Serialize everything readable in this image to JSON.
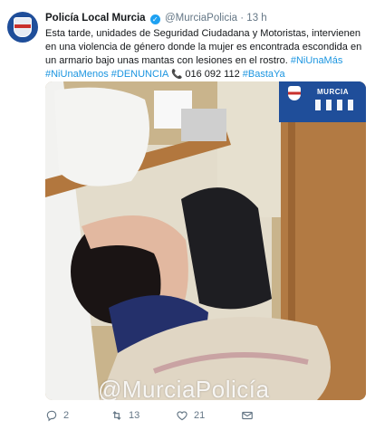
{
  "tweet": {
    "name": "Policía Local Murcia",
    "handle": "@MurciaPolicia",
    "separator": "·",
    "time": "13 h",
    "text_parts": [
      {
        "text": "Esta tarde, unidades de Seguridad Ciudadana y Motoristas, intervienen en una violencia de género donde la mujer es encontrada escondida en un armario bajo unas mantas con lesiones en el rostro. ",
        "type": "plain"
      },
      {
        "text": "#NiUnaMás",
        "type": "tag"
      },
      {
        "text": " ",
        "type": "plain"
      },
      {
        "text": "#NiUnaMenos",
        "type": "tag"
      },
      {
        "text": " ",
        "type": "plain"
      },
      {
        "text": "#DENUNCIA",
        "type": "tag"
      },
      {
        "text": " 📞 ",
        "type": "emoji"
      },
      {
        "text": "016 092 112 ",
        "type": "plain"
      },
      {
        "text": "#BastaYa",
        "type": "tag"
      }
    ]
  },
  "media": {
    "badge_title": "MURCIA",
    "watermark": "@MurciaPolicía"
  },
  "actions": {
    "replies": "2",
    "retweets": "13",
    "likes": "21"
  },
  "colors": {
    "link": "#1b95e0",
    "brand_blue": "#1f4e9a",
    "meta_gray": "#657786"
  }
}
